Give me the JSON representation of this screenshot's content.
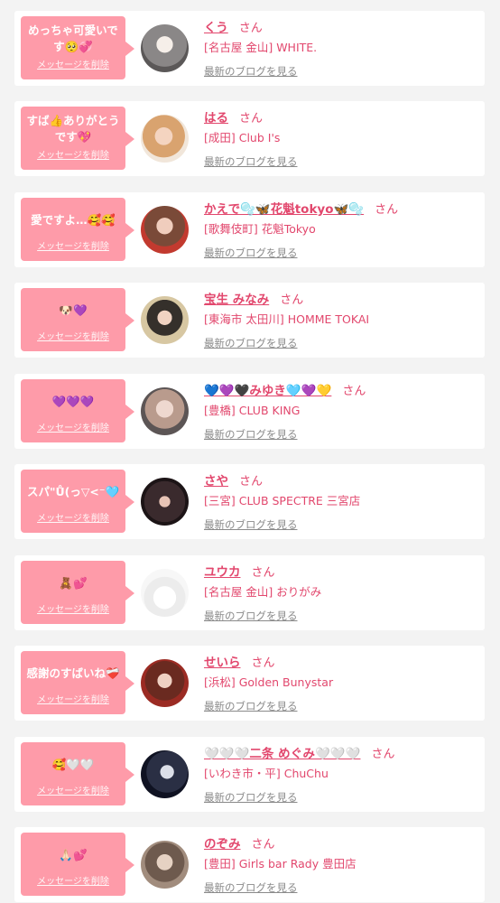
{
  "delete_label": "メッセージを削除",
  "blog_label": "最新のブログを見る",
  "san_label": "さん",
  "colors": {
    "accent": "#e2476d",
    "bubble": "#fe9ba9",
    "background": "#f3f3f3"
  },
  "entries": [
    {
      "message": "めっちゃ可愛いです🥺💞",
      "name": "くう",
      "shop": "[名古屋 金山] WHITE."
    },
    {
      "message": "すば👍ありがとうです💖",
      "name": "はる",
      "shop": "[成田] Club I's"
    },
    {
      "message": "愛ですよ…🥰🥰",
      "name": "かえで🫧🦋花魁tokyo🦋🫧",
      "shop": "[歌舞伎町] 花魁Tokyo"
    },
    {
      "message": "🐶💜",
      "name": "宝生 みなみ",
      "shop": "[東海市 太田川] HOMME TOKAI"
    },
    {
      "message": "💜💜💜",
      "name": "💙💜🖤みゆき🩵💜💛",
      "shop": "[豊橋] CLUB KING"
    },
    {
      "message": "スパ\"Ů(っ▽<⁻🩵",
      "name": "さや",
      "shop": "[三宮] CLUB SPECTRE 三宮店"
    },
    {
      "message": "🧸💕",
      "name": "ユウカ",
      "shop": "[名古屋 金山] おりがみ"
    },
    {
      "message": "感謝のすばいね❤️‍🩹",
      "name": "せいら",
      "shop": "[浜松] Golden Bunystar"
    },
    {
      "message": "🥰🤍🤍",
      "name": "🤍🤍🤍二条 めぐみ🤍🤍🤍",
      "shop": "[いわき市・平] ChuChu"
    },
    {
      "message": "🙏🏻💕",
      "name": "のぞみ",
      "shop": "[豊田] Girls bar Rady 豊田店"
    }
  ]
}
